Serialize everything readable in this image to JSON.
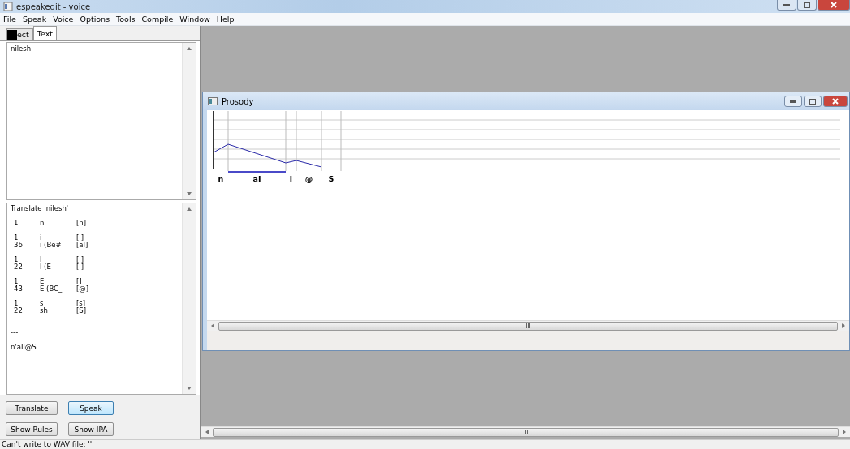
{
  "window": {
    "title": "espeakedit -  voice"
  },
  "menu": [
    "File",
    "Speak",
    "Voice",
    "Options",
    "Tools",
    "Compile",
    "Window",
    "Help"
  ],
  "tabs": [
    {
      "label": "ect",
      "selected": false
    },
    {
      "label": "Text",
      "selected": true
    }
  ],
  "text_input": {
    "value": "nilesh"
  },
  "output": {
    "header": "Translate 'nilesh'",
    "groups": [
      [
        {
          "number": "1",
          "match": "n",
          "phonemes": "[n]"
        }
      ],
      [
        {
          "number": "1",
          "match": "i",
          "phonemes": "[I]"
        },
        {
          "number": "36",
          "match": "i (Be#",
          "phonemes": "[aI]"
        }
      ],
      [
        {
          "number": "1",
          "match": "l",
          "phonemes": "[l]"
        },
        {
          "number": "22",
          "match": "l (E",
          "phonemes": "[l]"
        }
      ],
      [
        {
          "number": "1",
          "match": "E",
          "phonemes": "[]"
        },
        {
          "number": "43",
          "match": "E (BC_",
          "phonemes": "[@]"
        }
      ],
      [
        {
          "number": "1",
          "match": "s",
          "phonemes": "[s]"
        },
        {
          "number": "22",
          "match": "sh",
          "phonemes": "[S]"
        }
      ]
    ],
    "separator": "---",
    "result": "n'aIl@S"
  },
  "buttons": [
    {
      "label": "Translate",
      "focused": false
    },
    {
      "label": "Speak",
      "focused": true
    },
    {
      "label": "Show Rules",
      "focused": false
    },
    {
      "label": "Show IPA",
      "focused": false
    }
  ],
  "prosody": {
    "title": "Prosody",
    "phonemes": [
      {
        "label": "n",
        "selected": false
      },
      {
        "label": "aI",
        "selected": true
      },
      {
        "label": "l",
        "selected": false
      },
      {
        "label": "@",
        "selected": false
      },
      {
        "label": "S",
        "selected": false
      }
    ]
  },
  "status_bar": "Can't write to WAV file: ''"
}
